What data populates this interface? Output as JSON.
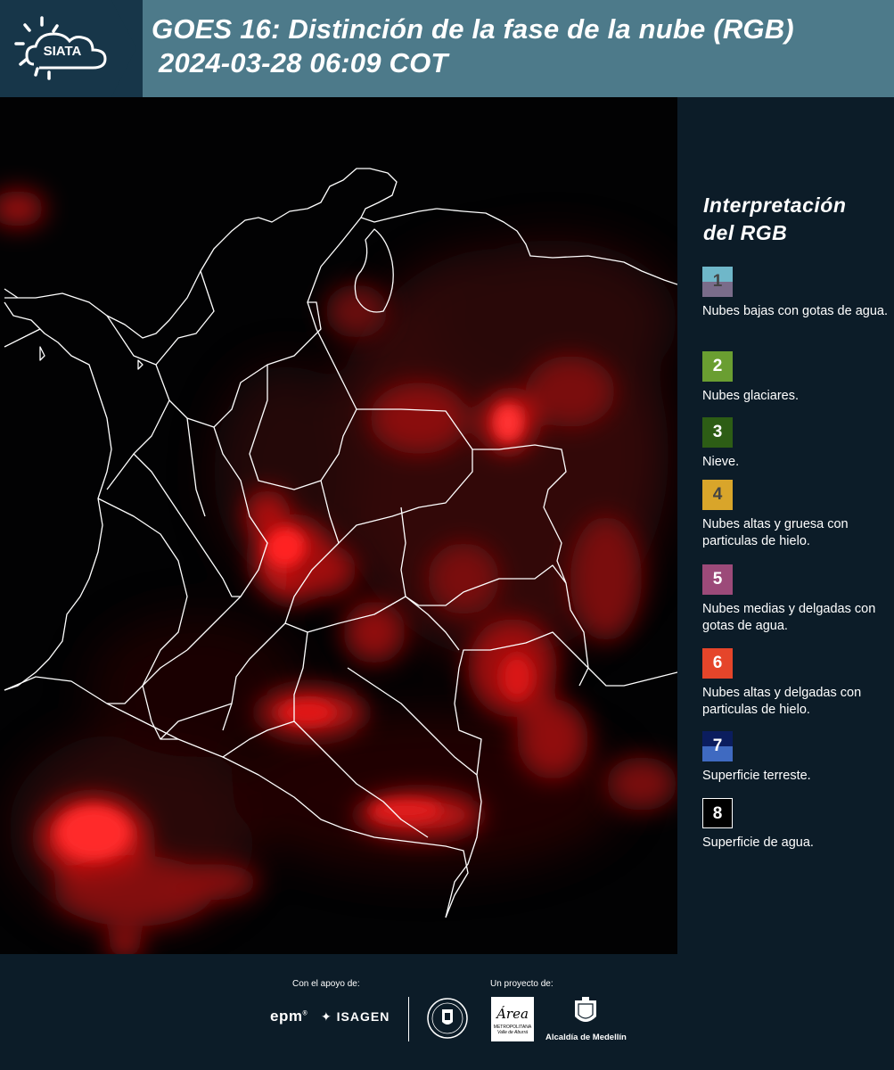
{
  "header": {
    "logo_text": "SIATA",
    "title_line1": "GOES 16: Distinción de la fase de la nube (RGB)",
    "title_line2": "2024-03-28 06:09 COT"
  },
  "legend": {
    "title_line1": "Interpretación",
    "title_line2": "del RGB",
    "items": [
      {
        "number": "1",
        "label": "Nubes bajas con gotas de agua.",
        "color_top": "#6fb7c9",
        "color_bottom": "#7a6c8a"
      },
      {
        "number": "2",
        "label": "Nubes glaciares.",
        "color": "#6a9e31"
      },
      {
        "number": "3",
        "label": "Nieve.",
        "color": "#2d5d15"
      },
      {
        "number": "4",
        "label": "Nubes altas y gruesa con particulas de hielo.",
        "color": "#d9a52a"
      },
      {
        "number": "5",
        "label": "Nubes medias y delgadas con gotas de agua.",
        "color": "#9c4a79"
      },
      {
        "number": "6",
        "label": "Nubes altas y delgadas con particulas de hielo.",
        "color": "#e5452a"
      },
      {
        "number": "7",
        "label": "Superficie terreste.",
        "color_top": "#0b1d5e",
        "color_bottom": "#3f6ac1"
      },
      {
        "number": "8",
        "label": "Superficie de agua.",
        "color": "#000000"
      }
    ]
  },
  "footer": {
    "support_label": "Con el apoyo de:",
    "project_label": "Un proyecto de:",
    "sponsor_epm": "epm",
    "sponsor_isagen": "ISAGEN",
    "area_name": "Área",
    "area_subtitle": "METROPOLITANA",
    "area_subtitle2": "Valle de Aburrá",
    "alcaldia": "Alcaldía de Medellín"
  }
}
